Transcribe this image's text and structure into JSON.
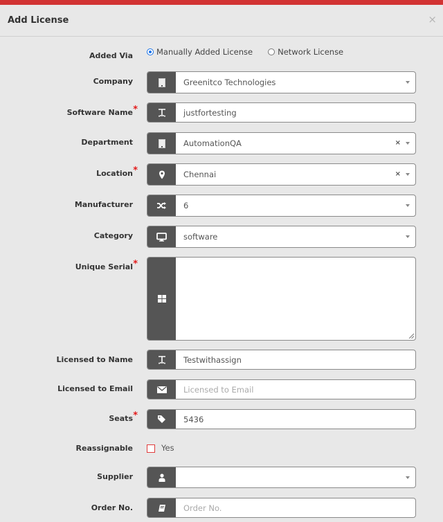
{
  "modal": {
    "title": "Add License",
    "close_label": "×"
  },
  "added_via": {
    "label": "Added Via",
    "options": [
      {
        "label": "Manually Added License",
        "selected": true
      },
      {
        "label": "Network License",
        "selected": false
      }
    ]
  },
  "fields": {
    "company": {
      "label": "Company",
      "icon": "building-icon",
      "value": "Greenitco Technologies",
      "type": "select",
      "required": false
    },
    "software_name": {
      "label": "Software Name",
      "icon": "text-icon",
      "value": "justfortesting",
      "type": "text",
      "required": true
    },
    "department": {
      "label": "Department",
      "icon": "building-icon",
      "value": "AutomationQA",
      "type": "select",
      "clearable": true,
      "required": false
    },
    "location": {
      "label": "Location",
      "icon": "map-marker-icon",
      "value": "Chennai",
      "type": "select",
      "clearable": true,
      "required": true
    },
    "manufacturer": {
      "label": "Manufacturer",
      "icon": "shuffle-icon",
      "value": "6",
      "type": "select",
      "required": false
    },
    "category": {
      "label": "Category",
      "icon": "desktop-icon",
      "value": "software",
      "type": "select",
      "required": false
    },
    "unique_serial": {
      "label": "Unique Serial",
      "icon": "grid-icon",
      "value": "",
      "type": "textarea",
      "required": true
    },
    "licensed_to_name": {
      "label": "Licensed to Name",
      "icon": "text-icon",
      "value": "Testwithassign",
      "type": "text",
      "required": false
    },
    "licensed_to_email": {
      "label": "Licensed to Email",
      "icon": "envelope-icon",
      "value": "",
      "placeholder": "Licensed to Email",
      "type": "text",
      "required": false
    },
    "seats": {
      "label": "Seats",
      "icon": "tag-icon",
      "value": "5436",
      "type": "text",
      "required": true
    },
    "reassignable": {
      "label": "Reassignable",
      "checkbox_label": "Yes",
      "checked": false
    },
    "supplier": {
      "label": "Supplier",
      "icon": "user-icon",
      "value": "",
      "type": "select",
      "required": false
    },
    "order_no": {
      "label": "Order No.",
      "icon": "book-icon",
      "value": "",
      "placeholder": "Order No.",
      "type": "text",
      "required": false
    }
  },
  "required_marker": "*",
  "clear_glyph": "×",
  "colors": {
    "accent": "#d23333",
    "addon": "#555555",
    "required": "#e31b1b",
    "radio": "#1a73e8"
  }
}
